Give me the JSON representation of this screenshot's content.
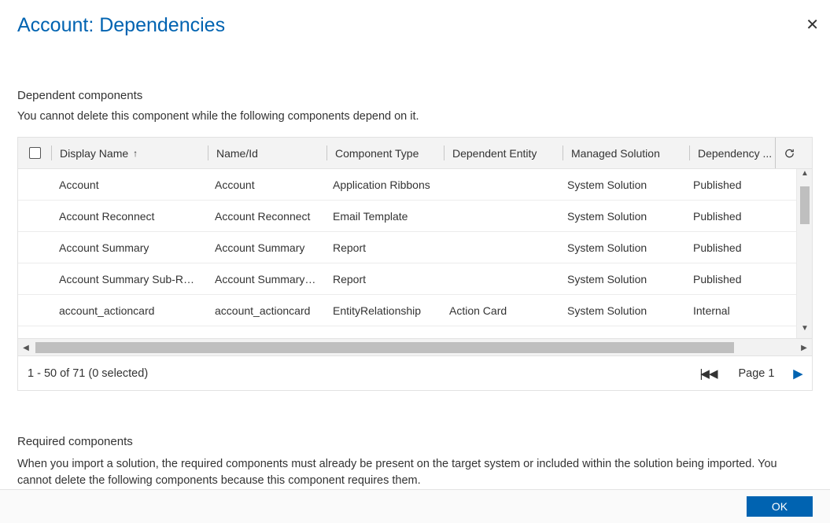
{
  "dialog": {
    "title": "Account: Dependencies",
    "close_icon": "close-icon"
  },
  "dependent": {
    "heading": "Dependent components",
    "subtext": "You cannot delete this component while the following components depend on it.",
    "columns": {
      "display_name": "Display Name",
      "name_id": "Name/Id",
      "component_type": "Component Type",
      "dependent_entity": "Dependent Entity",
      "managed_solution": "Managed Solution",
      "dependency_type": "Dependency ...",
      "sort_indicator": "↑"
    },
    "rows": [
      {
        "display": "Account",
        "name": "Account",
        "ctype": "Application Ribbons",
        "dent": "",
        "sol": "System Solution",
        "deptype": "Published"
      },
      {
        "display": "Account Reconnect",
        "name": "Account Reconnect",
        "ctype": "Email Template",
        "dent": "",
        "sol": "System Solution",
        "deptype": "Published"
      },
      {
        "display": "Account Summary",
        "name": "Account Summary",
        "ctype": "Report",
        "dent": "",
        "sol": "System Solution",
        "deptype": "Published"
      },
      {
        "display": "Account Summary Sub-Report",
        "name": "Account Summary S...",
        "ctype": "Report",
        "dent": "",
        "sol": "System Solution",
        "deptype": "Published"
      },
      {
        "display": "account_actioncard",
        "name": "account_actioncard",
        "ctype": "EntityRelationship",
        "dent": "Action Card",
        "sol": "System Solution",
        "deptype": "Internal"
      }
    ],
    "partial_row": {
      "display": "",
      "name": "",
      "ctype": "",
      "dent": "",
      "sol": "",
      "deptype": ""
    },
    "footer": {
      "status": "1 - 50 of 71 (0 selected)",
      "page_label": "Page 1"
    }
  },
  "required": {
    "heading": "Required components",
    "subtext": "When you import a solution, the required components must already be present on the target system or included within the solution being imported. You cannot delete the following components because this component requires them."
  },
  "footer": {
    "ok_label": "OK"
  }
}
